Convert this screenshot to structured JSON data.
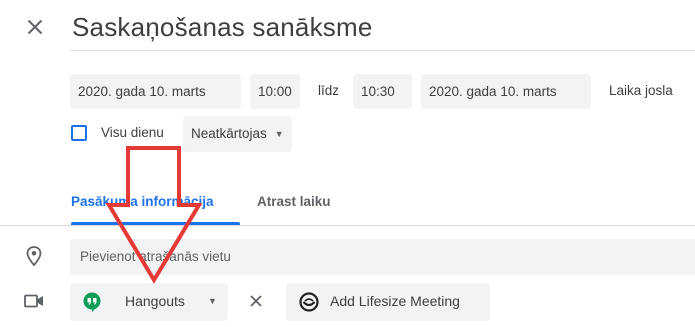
{
  "event": {
    "title": "Saskaņošanas sanāksme",
    "start_date": "2020. gada 10. marts",
    "start_time": "10:00",
    "until": "līdz",
    "end_time": "10:30",
    "end_date": "2020. gada 10. marts",
    "timezone_label": "Laika josla",
    "all_day_label": "Visu dienu",
    "all_day_checked": false,
    "repeat_value": "Neatkārtojas"
  },
  "tabs": [
    {
      "label": "Pasākuma informācija",
      "active": true
    },
    {
      "label": "Atrast laiku",
      "active": false
    }
  ],
  "location": {
    "placeholder": "Pievienot atrašanās vietu",
    "icon": "location-pin-icon"
  },
  "conferencing": {
    "icon": "video-camera-icon",
    "provider": "Hangouts",
    "add_button_label": "Add Lifesize Meeting"
  },
  "icons": {
    "close": "close-icon",
    "dropdown": "chevron-down-icon",
    "remove": "remove-x-icon"
  },
  "annotation": {
    "type": "red-arrow-down",
    "color": "#e53935"
  },
  "colors": {
    "accent": "#1a73e8",
    "chip_bg": "#f1f3f4",
    "hangouts_green": "#0f9d58",
    "annotation_red": "#e53935"
  }
}
